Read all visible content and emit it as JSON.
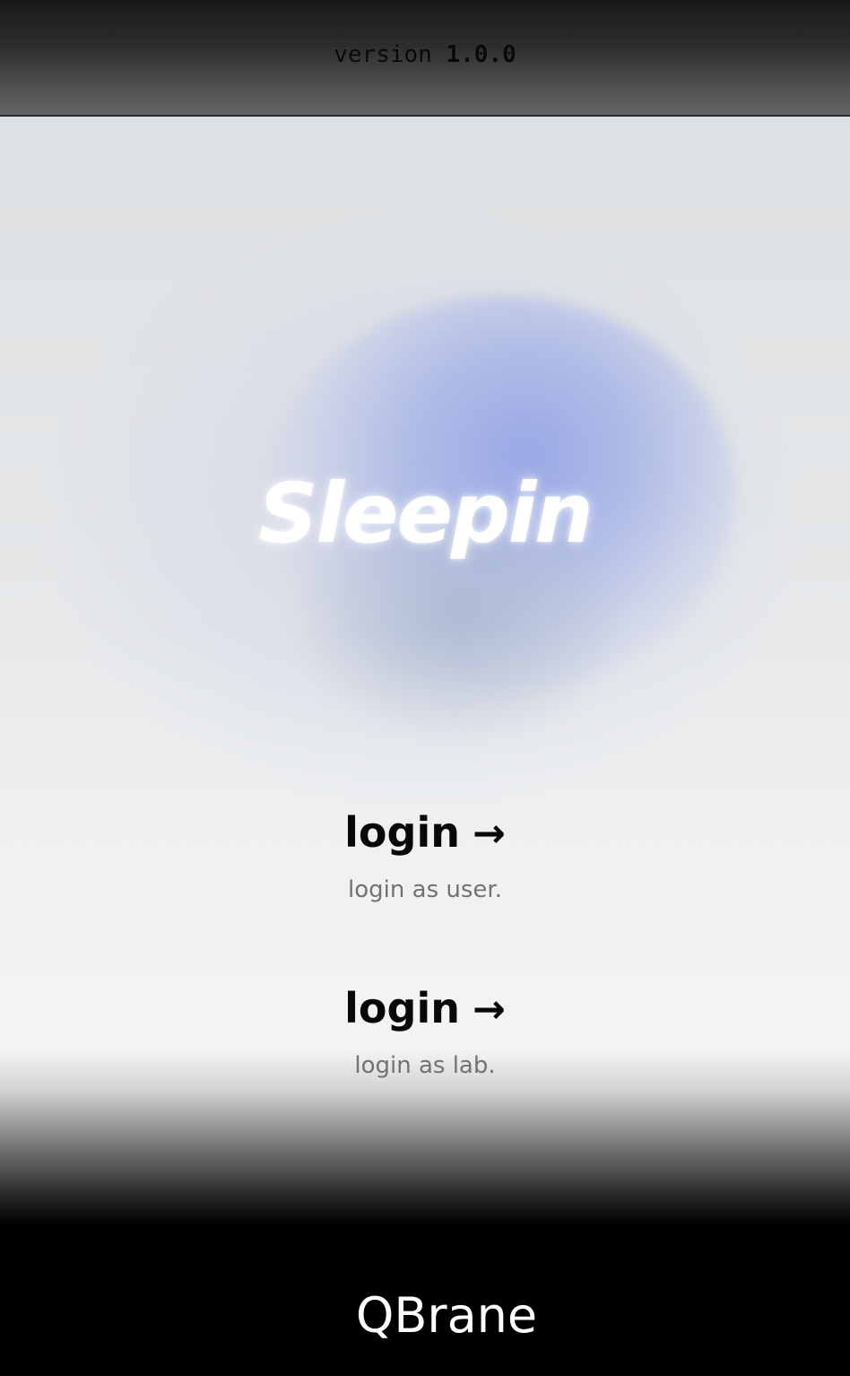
{
  "header": {
    "version_prefix": "version",
    "version_number": "1.0.0"
  },
  "hero": {
    "app_name": "Sleepin"
  },
  "logins": [
    {
      "label": "login",
      "arrow": "→",
      "description": "login as user."
    },
    {
      "label": "login",
      "arrow": "→",
      "description": "login as lab."
    }
  ],
  "footer": {
    "brand": "QBrane"
  },
  "colors": {
    "accent_glow": "#a4b1e6",
    "header_dark": "#18191b",
    "footer_bg": "#000000",
    "description_text": "#727272"
  }
}
